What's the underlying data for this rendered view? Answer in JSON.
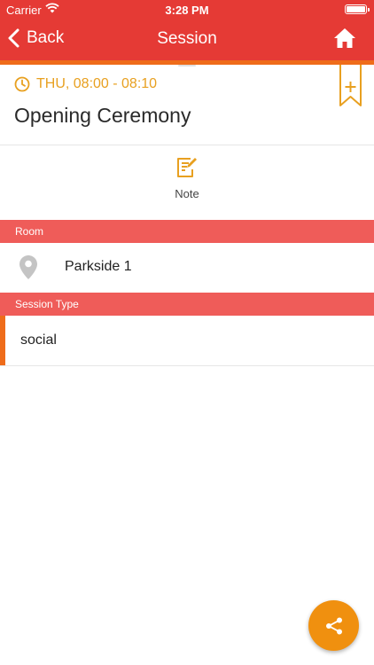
{
  "status_bar": {
    "carrier": "Carrier",
    "time": "3:28 PM"
  },
  "nav": {
    "back_label": "Back",
    "title": "Session",
    "home_icon": "home-icon"
  },
  "session": {
    "time": "THU, 08:00 - 08:10",
    "title": "Opening Ceremony",
    "bookmark_icon": "bookmark-plus-icon"
  },
  "actions": {
    "note_label": "Note",
    "note_icon": "edit-note-icon"
  },
  "room": {
    "header": "Room",
    "name": "Parkside 1",
    "icon": "map-pin-icon"
  },
  "session_type": {
    "header": "Session Type",
    "value": "social"
  },
  "share": {
    "icon": "share-icon"
  },
  "colors": {
    "header_red": "#e53a35",
    "accent_orange": "#ef6c1a",
    "time_gold": "#e8a020",
    "section_red": "#ef5c59",
    "share_orange": "#f0900f"
  }
}
